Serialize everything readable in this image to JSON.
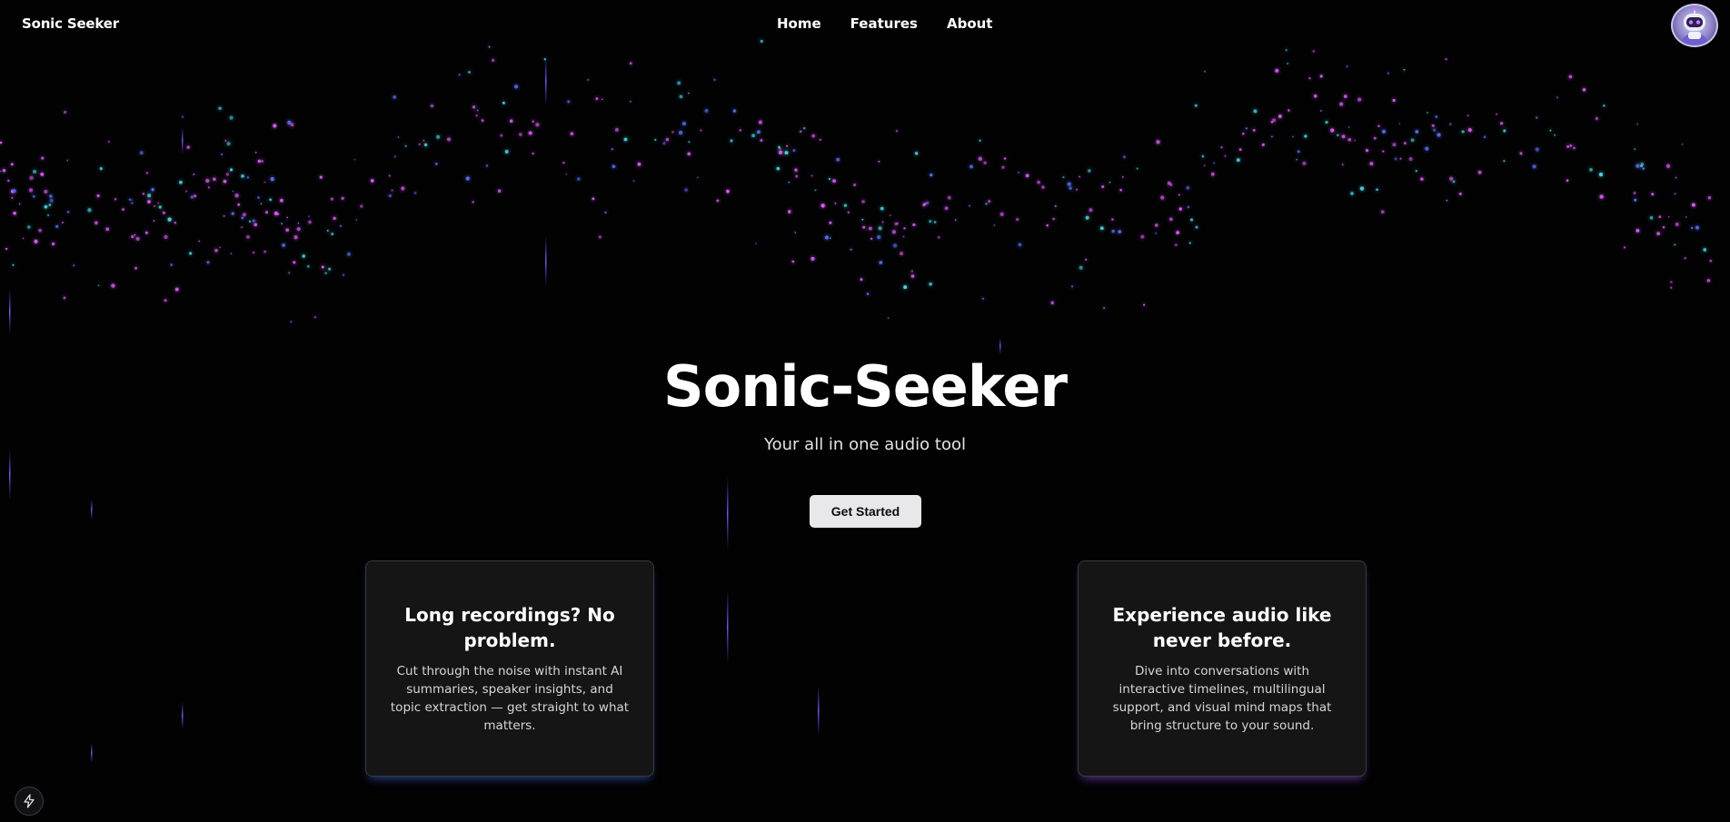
{
  "nav": {
    "brand": "Sonic Seeker",
    "links": [
      "Home",
      "Features",
      "About"
    ]
  },
  "hero": {
    "title": "Sonic-Seeker",
    "subtitle": "Your all in one audio tool",
    "cta": "Get Started"
  },
  "features": [
    {
      "title": "Long recordings? No problem.",
      "body": "Cut through the noise with instant AI summaries, speaker insights, and topic extraction — get straight to what matters."
    },
    {
      "title": "Experience audio like never before.",
      "body": "Dive into conversations with interactive timelines, multilingual support, and visual mind maps that bring structure to your sound."
    }
  ],
  "icons": {
    "avatar": "robot-avatar-icon",
    "bolt": "lightning-bolt-icon"
  },
  "colors": {
    "background": "#020203",
    "particle_pink": "#d65cf0",
    "particle_cyan": "#4fd0e0",
    "particle_blue": "#5a6cf0",
    "card_bg": "#151516",
    "cta_bg": "#e8e8ea"
  }
}
